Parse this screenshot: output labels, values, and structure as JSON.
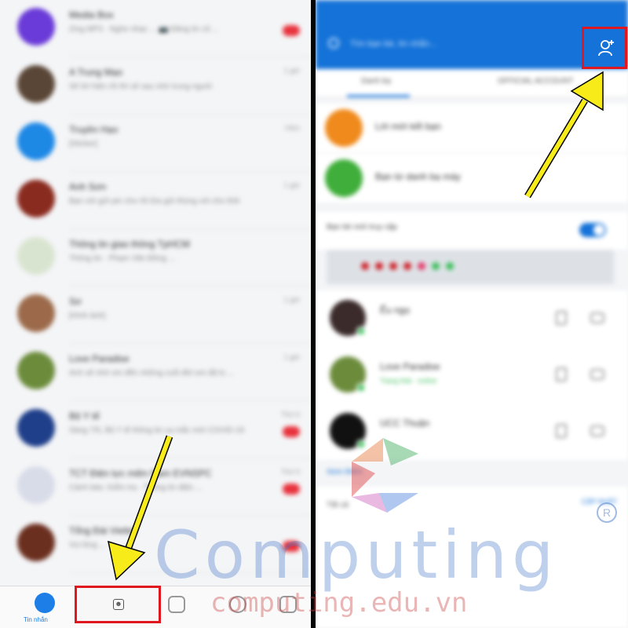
{
  "left_panel": {
    "chats": [
      {
        "name": "Media Box",
        "preview": "Zing MP3 · Nghe nhạc ... 📷 Đăng tin cũ ...",
        "time": "",
        "unread": true,
        "avatar_color": "#6a3bd8"
      },
      {
        "name": "A Trung Mạo",
        "preview": "Sẽ lời hiện rồi thì sẽ sau nhờ trung nguời",
        "time": "1 giờ",
        "unread": false,
        "avatar_color": "#5a4636"
      },
      {
        "name": "Truyền Hạo",
        "preview": "[Sticker]",
        "time": "Hôm",
        "unread": false,
        "avatar_color": "#1e88e5"
      },
      {
        "name": "Anh Sơn",
        "preview": "Bạn với gửi pin cho rồi lửa gửi thùng với cho thôi",
        "time": "1 giờ",
        "unread": false,
        "avatar_color": "#8a2b1f"
      },
      {
        "name": "Thông tin giao thông TpHCM",
        "preview": "Thông tin · Phạm Văn Đồng ...",
        "time": "",
        "unread": false,
        "avatar_color": "#d9e4d0"
      },
      {
        "name": "Sơ",
        "preview": "[Hình ảnh]",
        "time": "1 giờ",
        "unread": false,
        "avatar_color": "#9c6a4a"
      },
      {
        "name": "Love Paradise",
        "preview": "Anh sẽ nhớ em đến những cuối đời em đã lo ...",
        "time": "1 giờ",
        "unread": false,
        "avatar_color": "#6c8c3c"
      },
      {
        "name": "Bộ Y tế",
        "preview": "Sáng 7/5, Bộ Y tế thông tin ca mắc mới COVID-19",
        "time": "Thứ 6",
        "unread": true,
        "avatar_color": "#1f3f8a"
      },
      {
        "name": "TCT Điện lực miền Nam EVNSPC",
        "preview": "Cảnh báo: Kiểm tra · Thông tin điện ...",
        "time": "Thứ 6",
        "unread": true,
        "avatar_color": "#d8dce8"
      },
      {
        "name": "Tổng Đài Viettel",
        "preview": "Vui lòng ...",
        "time": "",
        "unread": true,
        "avatar_color": "#6b2f1f"
      }
    ],
    "bottom_nav": {
      "messages_label": "Tin nhắn",
      "contacts_icon": "contacts-icon"
    }
  },
  "right_panel": {
    "search_placeholder": "Tìm bạn bè, tin nhắn...",
    "tabs": [
      "Danh bạ",
      "OFFICIAL ACCOUNT"
    ],
    "actions": [
      {
        "label": "Lời mời kết bạn",
        "color": "#f08a1c"
      },
      {
        "label": "Bạn từ danh bạ máy",
        "color": "#3fae3a"
      }
    ],
    "online_section_label": "Bạn bè mới truy cập",
    "contacts": [
      {
        "name": "Ếu ngọ",
        "sub": "",
        "avatar_color": "#3b2b2b"
      },
      {
        "name": "Love Paradise",
        "sub": "Trạng thái · online",
        "avatar_color": "#6c8c3c"
      },
      {
        "name": "UCC Thuận",
        "sub": "",
        "avatar_color": "#111111"
      }
    ],
    "see_more": "Xem thêm",
    "bottom_label": "Tất cả",
    "bottom_pill": "CẬP NHẬT"
  },
  "watermark": {
    "word": "Computing",
    "url": "computing.edu.vn",
    "registered": "R"
  },
  "colors": {
    "zalo_blue": "#1472d8",
    "highlight_red": "#e0171e",
    "arrow_yellow": "#f7ec1a"
  }
}
